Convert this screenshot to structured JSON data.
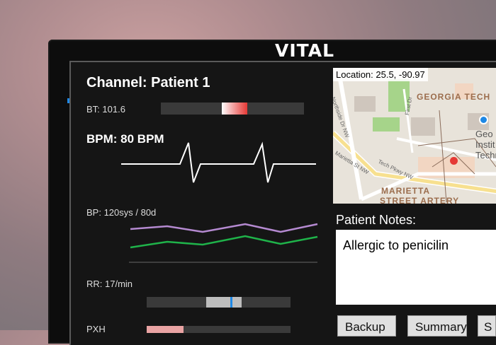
{
  "brand": "VITAL",
  "channel": {
    "title": "Channel: Patient 1"
  },
  "bt": {
    "label": "BT: 101.6"
  },
  "bpm": {
    "label": "BPM: 80 BPM"
  },
  "bp": {
    "label": "BP: 120sys / 80d"
  },
  "rr": {
    "label": "RR: 17/min"
  },
  "next_label_partial": "PXH",
  "map": {
    "location": "Location: 25.5, -90.97",
    "labels": {
      "georgia_tech": "GEORGIA TECH",
      "geo_inst": "Geo Instit Techn",
      "marietta": "MARIETTA",
      "street_artery": "STREET ARTERY"
    },
    "streets": {
      "northside": "Northside Dr NW",
      "first_dr": "First Dr",
      "marietta_st": "Marietta St NW",
      "tech_pkwy": "Tech Pkwy NW"
    },
    "colors": {
      "marker_red": "#e53935",
      "marker_blue": "#1e88e5",
      "park": "#a6d48a"
    }
  },
  "notes": {
    "title": "Patient Notes:",
    "text": "Allergic to penicilin"
  },
  "buttons": {
    "backup": "Backup",
    "summary": "Summary",
    "third": "S"
  },
  "colors": {
    "bp_systolic": "#b58ad1",
    "bp_diastolic": "#1fb34a",
    "bt_bar_fill": "#e53935",
    "rr_marker": "#1e88e5"
  }
}
